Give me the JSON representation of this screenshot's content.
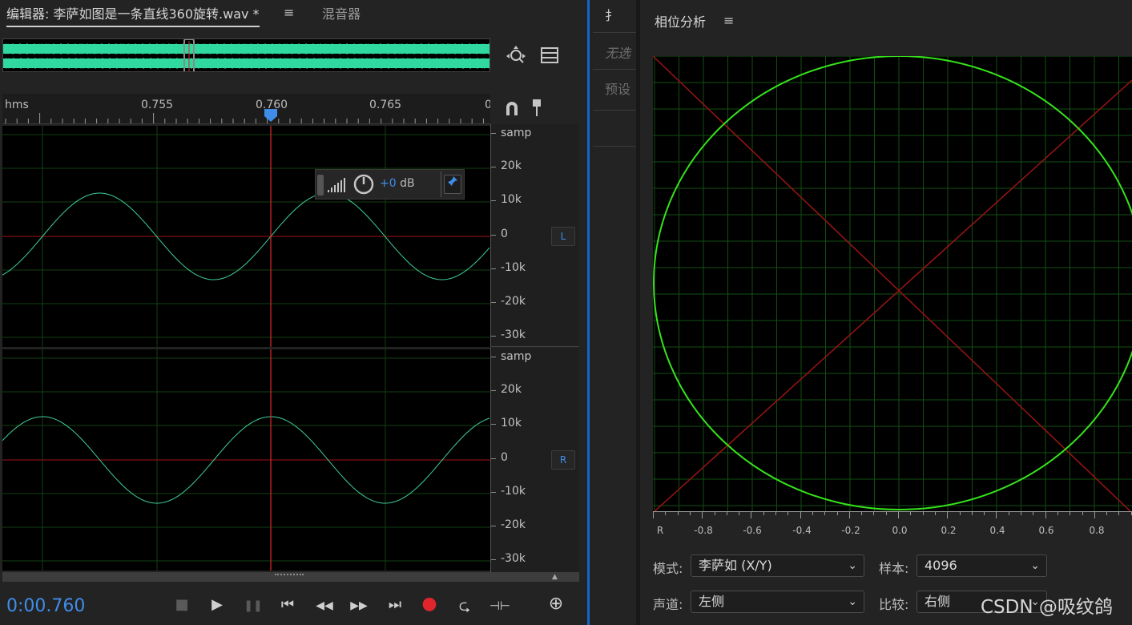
{
  "editor": {
    "tab_title": "编辑器: 李萨如图是一条直线360旋转.wav *",
    "tab_menu": "≡",
    "mixer_tab": "混音器",
    "overview_zoom_icon": "zoom-navigator-icon",
    "overview_list_icon": "list-icon",
    "ruler": {
      "unit": "hms",
      "labels": [
        "0.755",
        "0.760",
        "0.765",
        "0"
      ],
      "snap_icon": "magnet-icon",
      "marker_icon": "pin-marker-icon"
    },
    "channels": [
      {
        "badge": "L",
        "unit": "samp",
        "ticks": [
          "20k",
          "10k",
          "0",
          "-10k",
          "-20k",
          "-30k"
        ]
      },
      {
        "badge": "R",
        "unit": "samp",
        "ticks": [
          "20k",
          "10k",
          "0",
          "-10k",
          "-20k",
          "-30k"
        ]
      }
    ],
    "hud": {
      "sign": "+0",
      "unit": "dB"
    },
    "timecode": "0:00.760",
    "transport": {
      "stop": "■",
      "play": "▶",
      "pause": "❚❚",
      "to_start": "⏮",
      "rewind": "◀◀",
      "forward": "▶▶",
      "to_end": "⏭",
      "record": "●",
      "loop": "⮎",
      "skip": "⊣⊢",
      "zoom": "⊕"
    }
  },
  "middle": {
    "item1": "扌",
    "item2": "无选",
    "item3": "预设"
  },
  "phase": {
    "title": "相位分析",
    "menu": "≡",
    "scale": [
      "R",
      "-0.8",
      "-0.6",
      "-0.4",
      "-0.2",
      "0.0",
      "0.2",
      "0.4",
      "0.6",
      "0.8"
    ],
    "mode_label": "模式:",
    "mode_value": "李萨如 (X/Y)",
    "samples_label": "样本:",
    "samples_value": "4096",
    "channel_label": "声道:",
    "channel_value": "左侧",
    "compare_label": "比较:",
    "compare_value": "右侧",
    "colors": {
      "trace": "#36e21b",
      "grid": "#124f12",
      "diag": "#9a1414"
    }
  },
  "watermark": "CSDN @吸纹鸽"
}
